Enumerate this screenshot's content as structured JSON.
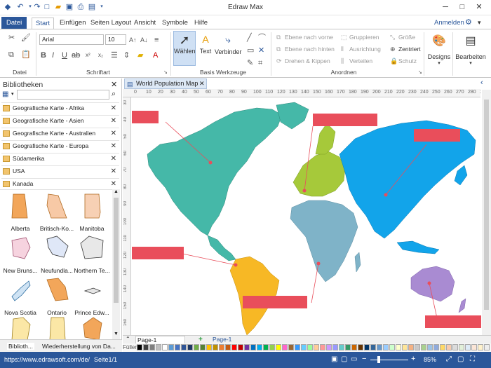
{
  "app": {
    "title": "Edraw Max",
    "signin": "Anmelden"
  },
  "tabs": [
    "Datei",
    "Start",
    "Einfügen",
    "Seiten Layout",
    "Ansicht",
    "Symbole",
    "Hilfe"
  ],
  "ribbon": {
    "groups": {
      "file": "Datei",
      "font": "Schriftart",
      "tools": "Basis Werkzeuge",
      "arrange": "Anordnen"
    },
    "font_name": "Arial",
    "font_size": "10",
    "tools": {
      "select": "Wählen",
      "text": "Text",
      "connector": "Verbinder"
    },
    "arrange": {
      "bring_front": "Ebene nach vorne",
      "send_back": "Ebene nach hinten",
      "rotate": "Drehen & Kippen",
      "group": "Gruppieren",
      "align": "Ausrichtung",
      "distribute": "Verteilen",
      "size": "Größe",
      "center": "Zentriert",
      "protect": "Schutz"
    },
    "designs": "Designs",
    "edit": "Bearbeiten"
  },
  "library": {
    "title": "Bibliotheken",
    "search_placeholder": "",
    "categories": [
      "Geografische Karte - Afrika",
      "Geografische Karte - Asien",
      "Geografische Karte - Australien",
      "Geografische Karte - Europa",
      "Südamerika",
      "USA",
      "Kanada"
    ],
    "shapes": [
      "Alberta",
      "Britisch-Ko...",
      "Manitoba",
      "New Bruns...",
      "Neufundla...",
      "Northern Te...",
      "Nova Scotia",
      "Ontario",
      "Prince Edw..."
    ],
    "bottom_tabs": [
      "Biblioth...",
      "Wiederherstellung von Da..."
    ]
  },
  "document": {
    "tab_title": "World Population Map",
    "ruler_top": [
      "0",
      "10",
      "20",
      "30",
      "40",
      "50",
      "60",
      "70",
      "80",
      "90",
      "100",
      "110",
      "120",
      "130",
      "140",
      "150",
      "160",
      "170",
      "180",
      "190",
      "200",
      "210",
      "220",
      "230",
      "240",
      "250",
      "260",
      "270",
      "280",
      "290"
    ],
    "ruler_left": [
      "30",
      "40",
      "50",
      "60",
      "70",
      "80",
      "90",
      "100",
      "110",
      "120",
      "130",
      "140",
      "150",
      "160"
    ],
    "page_select": "Page-1",
    "page_tab": "Page-1",
    "fill_label": "Füller"
  },
  "status": {
    "url": "https://www.edrawsoft.com/de/",
    "page": "Seite1/1",
    "zoom": "85%"
  },
  "colors": {
    "accent": "#2b579a",
    "label_red": "#e94e5b",
    "north_america": "#45b8a8",
    "south_america": "#f7b825",
    "europe": "#a6c93a",
    "africa": "#7fb3c8",
    "asia": "#12a4ea",
    "australia": "#a98bd2"
  }
}
